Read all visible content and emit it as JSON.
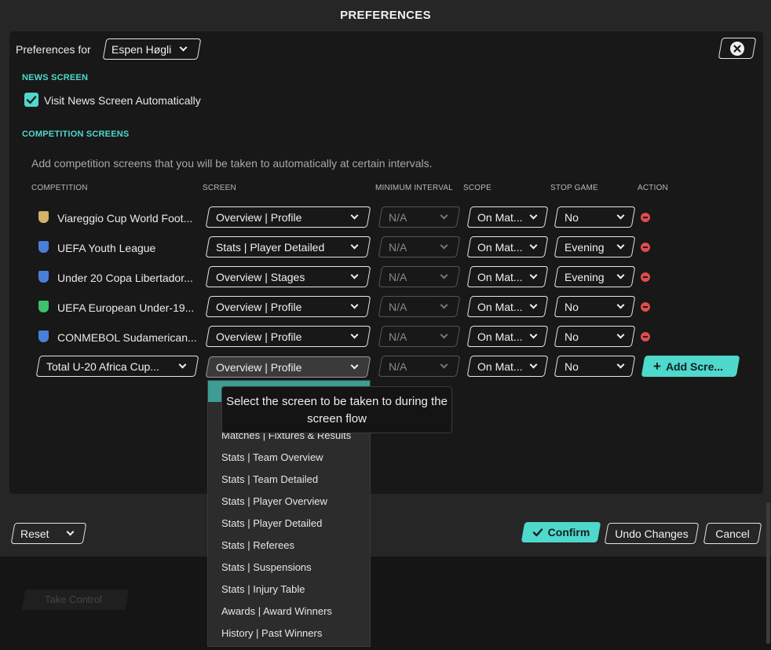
{
  "window": {
    "title": "PREFERENCES"
  },
  "header": {
    "prefs_for_label": "Preferences for",
    "user_select": "Espen Høgli"
  },
  "news": {
    "section_title": "NEWS SCREEN",
    "visit_label": "Visit News Screen Automatically",
    "visit_checked": true
  },
  "competition": {
    "section_title": "COMPETITION SCREENS",
    "description": "Add competition screens that you will be taken to automatically at certain intervals.",
    "columns": {
      "competition": "COMPETITION",
      "screen": "SCREEN",
      "min_interval": "MINIMUM INTERVAL",
      "scope": "SCOPE",
      "stop_game": "STOP GAME",
      "action": "ACTION"
    },
    "rows": [
      {
        "name": "Viareggio Cup World Foot...",
        "screen": "Overview | Profile",
        "interval": "N/A",
        "scope": "On Mat...",
        "stop": "No",
        "icon_color": "#d4b06a"
      },
      {
        "name": "UEFA Youth League",
        "screen": "Stats | Player Detailed",
        "interval": "N/A",
        "scope": "On Mat...",
        "stop": "Evening",
        "icon_color": "#4a7fd8"
      },
      {
        "name": "Under 20 Copa Libertador...",
        "screen": "Overview | Stages",
        "interval": "N/A",
        "scope": "On Mat...",
        "stop": "Evening",
        "icon_color": "#4a7fd8"
      },
      {
        "name": "UEFA European Under-19...",
        "screen": "Overview | Profile",
        "interval": "N/A",
        "scope": "On Mat...",
        "stop": "No",
        "icon_color": "#3fbf6a"
      },
      {
        "name": "CONMEBOL Sudamerican...",
        "screen": "Overview | Profile",
        "interval": "N/A",
        "scope": "On Mat...",
        "stop": "No",
        "icon_color": "#4a7fd8"
      }
    ],
    "new_row": {
      "competition": "Total U-20 Africa Cup...",
      "screen": "Overview | Profile",
      "interval": "N/A",
      "scope": "On Mat...",
      "stop": "No",
      "add_button": "Add Scre..."
    }
  },
  "dropdown": {
    "items": [
      "Overview | Profile",
      "Overview | Stages",
      "Matches | Fixtures & Results",
      "Stats | Team Overview",
      "Stats | Team Detailed",
      "Stats | Player Overview",
      "Stats | Player Detailed",
      "Stats | Referees",
      "Stats | Suspensions",
      "Stats | Injury Table",
      "Awards | Award Winners",
      "History | Past Winners"
    ]
  },
  "tooltip": {
    "text": "Select the screen to be taken to during the screen flow"
  },
  "footer": {
    "reset": "Reset",
    "confirm": "Confirm",
    "undo": "Undo Changes",
    "cancel": "Cancel"
  },
  "background": {
    "take_control": "Take Control"
  },
  "colors": {
    "accent": "#4fd8cc",
    "remove": "#e14b4b",
    "panel": "#181818"
  }
}
